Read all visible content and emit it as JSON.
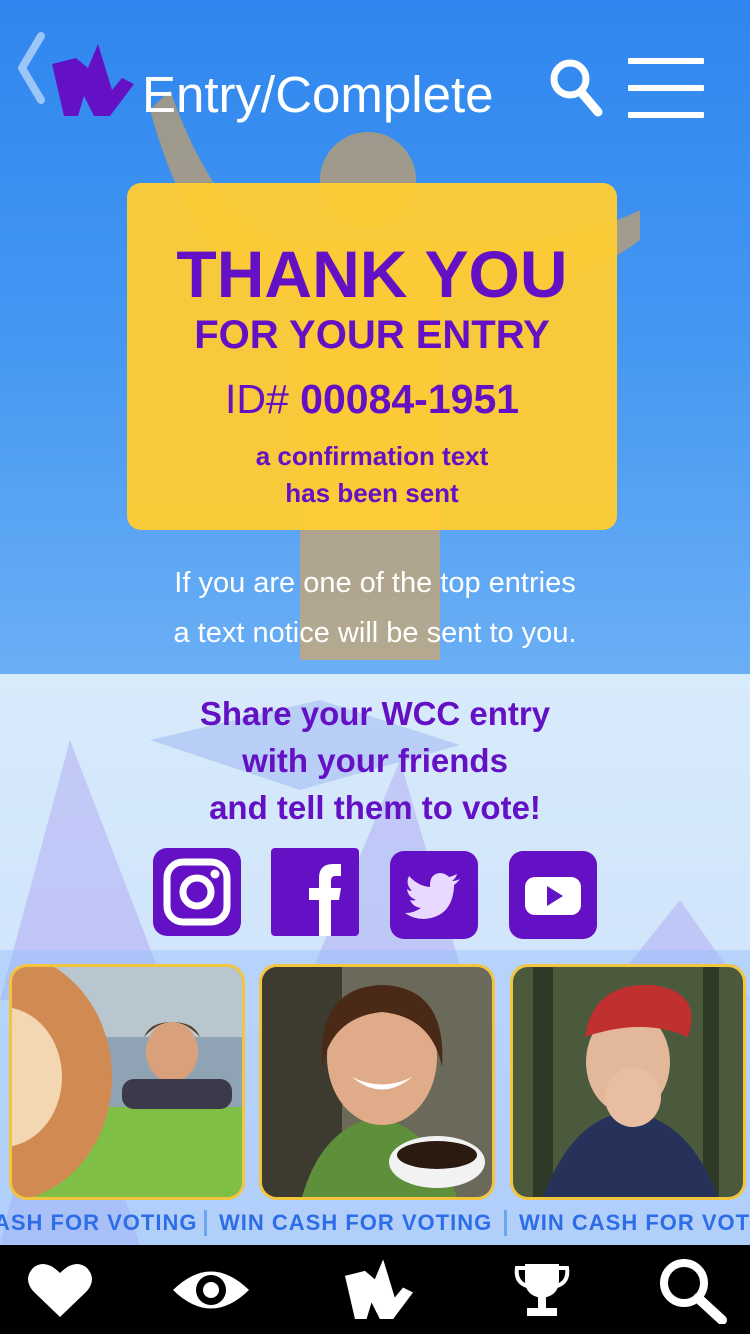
{
  "header": {
    "title": "Entry/Complete"
  },
  "card": {
    "thank_you": "THANK YOU",
    "for_entry": "FOR YOUR ENTRY",
    "id_prefix": "ID#",
    "id_value": "00084-1951",
    "confirmation_line1": "a confirmation text",
    "confirmation_line2": "has been sent"
  },
  "notice": {
    "line1": "If you are one of the top entries",
    "line2": "a text notice will be sent to you."
  },
  "share": {
    "line1": "Share your WCC entry",
    "line2": "with your friends",
    "line3": "and tell them to vote!"
  },
  "social": [
    "instagram-icon",
    "facebook-icon",
    "twitter-icon",
    "youtube-icon"
  ],
  "ticker": {
    "segment1": "ASH FOR VOTING",
    "segment2": "WIN CASH FOR VOTING",
    "segment3": "WIN CASH FOR VOTING"
  },
  "tabbar": [
    "heart-icon",
    "eye-icon",
    "wcc-logo-icon",
    "trophy-icon",
    "search-icon"
  ],
  "colors": {
    "accent_purple": "#6410c4",
    "card_yellow": "#ffcc33",
    "sky_blue": "#2f86ee",
    "ticker_blue": "#2d6ee8"
  }
}
